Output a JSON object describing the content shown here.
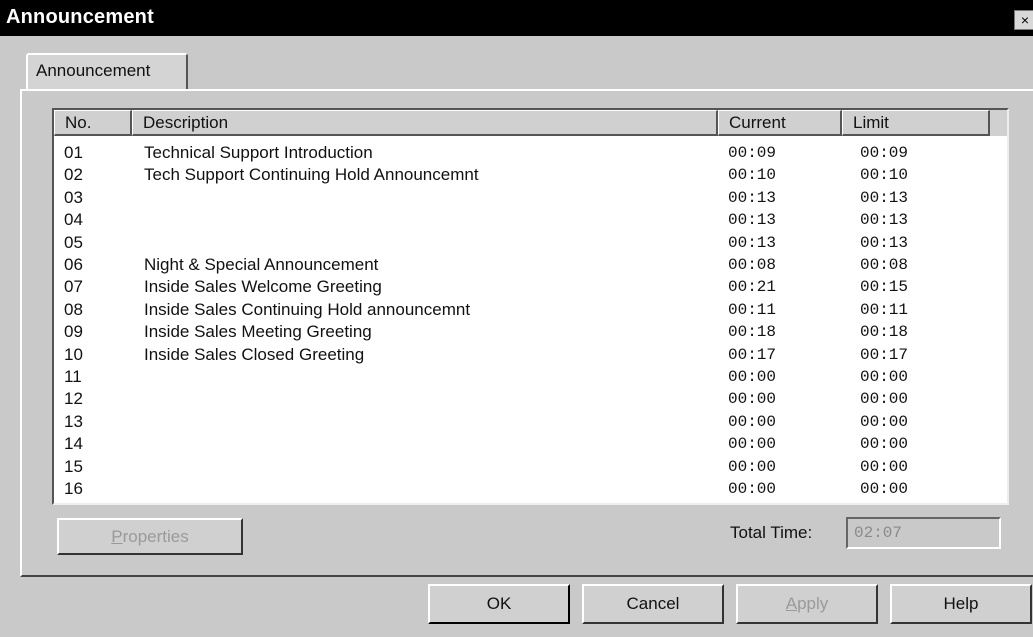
{
  "window": {
    "title": "Announcement",
    "close_label": "×"
  },
  "tab": {
    "label": "Announcement"
  },
  "columns": {
    "no": "No.",
    "description": "Description",
    "current": "Current",
    "limit": "Limit"
  },
  "rows": [
    {
      "no": "01",
      "description": "Technical Support Introduction",
      "current": "00:09",
      "limit": "00:09"
    },
    {
      "no": "02",
      "description": "Tech Support Continuing Hold Announcemnt",
      "current": "00:10",
      "limit": "00:10"
    },
    {
      "no": "03",
      "description": "",
      "current": "00:13",
      "limit": "00:13"
    },
    {
      "no": "04",
      "description": "",
      "current": "00:13",
      "limit": "00:13"
    },
    {
      "no": "05",
      "description": "",
      "current": "00:13",
      "limit": "00:13"
    },
    {
      "no": "06",
      "description": "Night & Special Announcement",
      "current": "00:08",
      "limit": "00:08"
    },
    {
      "no": "07",
      "description": "Inside Sales Welcome Greeting",
      "current": "00:21",
      "limit": "00:15"
    },
    {
      "no": "08",
      "description": "Inside Sales Continuing Hold announcemnt",
      "current": "00:11",
      "limit": "00:11"
    },
    {
      "no": "09",
      "description": "Inside Sales Meeting Greeting",
      "current": "00:18",
      "limit": "00:18"
    },
    {
      "no": "10",
      "description": "Inside Sales Closed Greeting",
      "current": "00:17",
      "limit": "00:17"
    },
    {
      "no": "11",
      "description": "",
      "current": "00:00",
      "limit": "00:00"
    },
    {
      "no": "12",
      "description": "",
      "current": "00:00",
      "limit": "00:00"
    },
    {
      "no": "13",
      "description": "",
      "current": "00:00",
      "limit": "00:00"
    },
    {
      "no": "14",
      "description": "",
      "current": "00:00",
      "limit": "00:00"
    },
    {
      "no": "15",
      "description": "",
      "current": "00:00",
      "limit": "00:00"
    },
    {
      "no": "16",
      "description": "",
      "current": "00:00",
      "limit": "00:00"
    }
  ],
  "properties_button": {
    "mnemonic": "P",
    "rest": "roperties"
  },
  "total_time": {
    "label": "Total Time:",
    "value": "02:07"
  },
  "buttons": {
    "ok": "OK",
    "cancel": "Cancel",
    "apply_mnemonic": "A",
    "apply_rest": "pply",
    "help": "Help"
  }
}
